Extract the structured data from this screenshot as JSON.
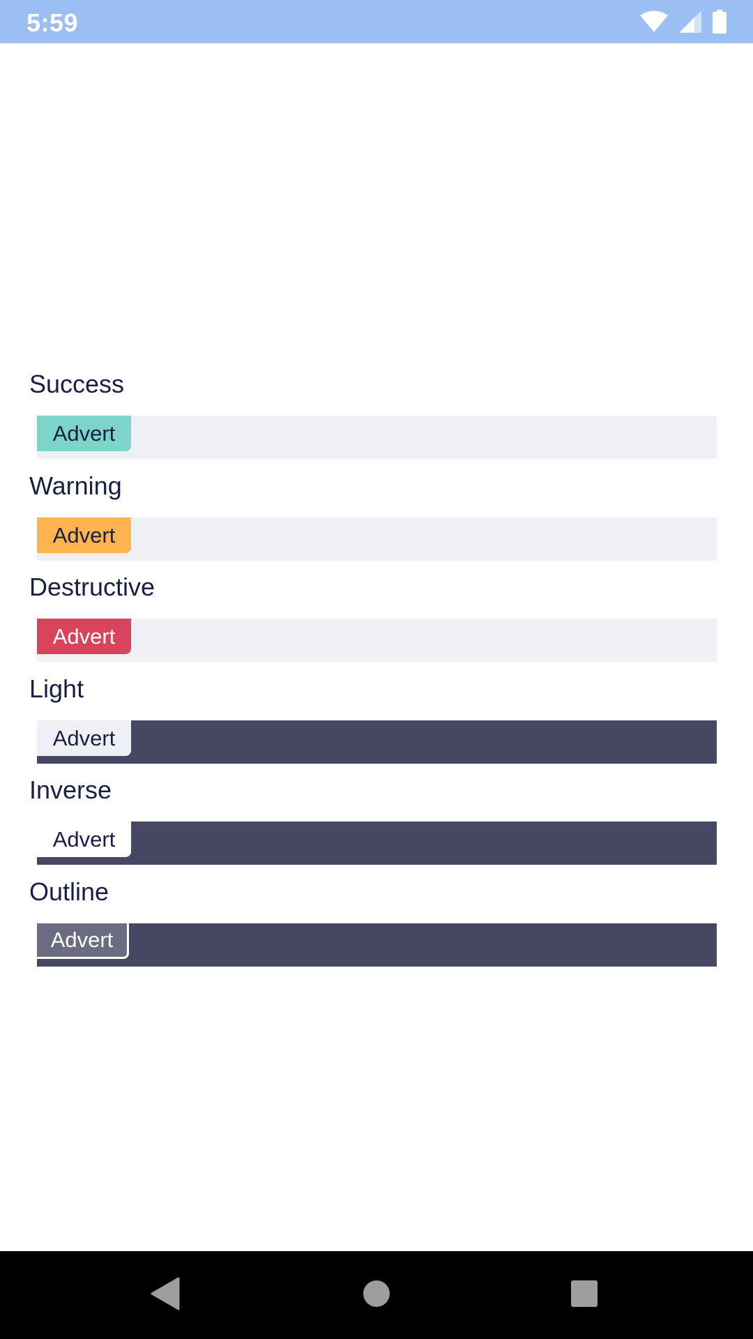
{
  "status_bar": {
    "time": "5:59",
    "icons": [
      "wifi-icon",
      "cellular-signal-icon",
      "battery-icon"
    ],
    "color": "#9bbff2"
  },
  "sections": [
    {
      "title": "Success",
      "badge": "Advert",
      "variant": "success",
      "badge_color": "#7dd4c8",
      "strip_color": "#eff0f5"
    },
    {
      "title": "Warning",
      "badge": "Advert",
      "variant": "warning",
      "badge_color": "#ffb44f",
      "strip_color": "#eff0f5"
    },
    {
      "title": "Destructive",
      "badge": "Advert",
      "variant": "destructive",
      "badge_color": "#d9445d",
      "strip_color": "#eff0f5"
    },
    {
      "title": "Light",
      "badge": "Advert",
      "variant": "light",
      "badge_color": "#eff0f5",
      "strip_color": "#464863"
    },
    {
      "title": "Inverse",
      "badge": "Advert",
      "variant": "inverse",
      "badge_color": "#ffffff",
      "strip_color": "#464863"
    },
    {
      "title": "Outline",
      "badge": "Advert",
      "variant": "outline",
      "badge_color": "#6b6c81",
      "strip_color": "#464863"
    }
  ],
  "nav_bar": {
    "buttons": [
      "back-icon",
      "home-icon",
      "recents-icon"
    ]
  }
}
